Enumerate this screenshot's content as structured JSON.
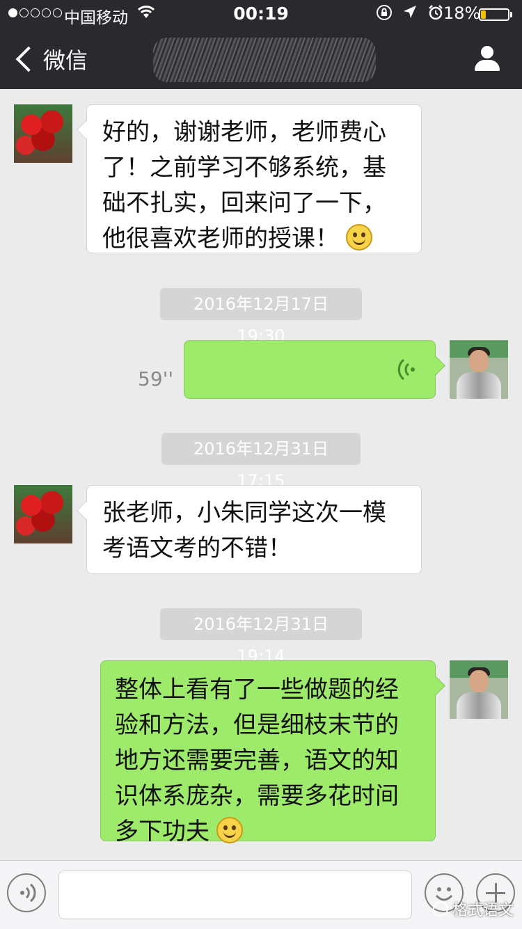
{
  "status_bar": {
    "carrier": "中国移动",
    "time": "00:19",
    "battery_percent": "18%",
    "battery_level": 0.18,
    "signal_bars_filled": 1,
    "signal_bars_total": 5
  },
  "nav": {
    "back_label": "微信",
    "title": ""
  },
  "messages": [
    {
      "from": "contact",
      "text": "好的，谢谢老师，老师费心了！之前学习不够系统，基础不扎实，回来问了一下，他很喜欢老师的授课！",
      "emoji": "smile"
    },
    {
      "timestamp": "2016年12月17日 19:30"
    },
    {
      "from": "me",
      "type": "voice",
      "duration": "59''"
    },
    {
      "timestamp": "2016年12月31日 17:15"
    },
    {
      "from": "contact",
      "text": "张老师，小朱同学这次一模考语文考的不错！"
    },
    {
      "timestamp": "2016年12月31日 19:14"
    },
    {
      "from": "me",
      "text": "整体上看有了一些做题的经验和方法，但是细枝末节的地方还需要完善，语文的知识体系庞杂，需要多花时间多下功夫",
      "emoji": "blush"
    }
  ],
  "input": {
    "placeholder": ""
  },
  "watermark": "格式语文",
  "colors": {
    "nav_bg": "#2a2a2e",
    "chat_bg": "#ebebeb",
    "outgoing_bubble": "#9eea6a",
    "incoming_bubble": "#ffffff"
  }
}
